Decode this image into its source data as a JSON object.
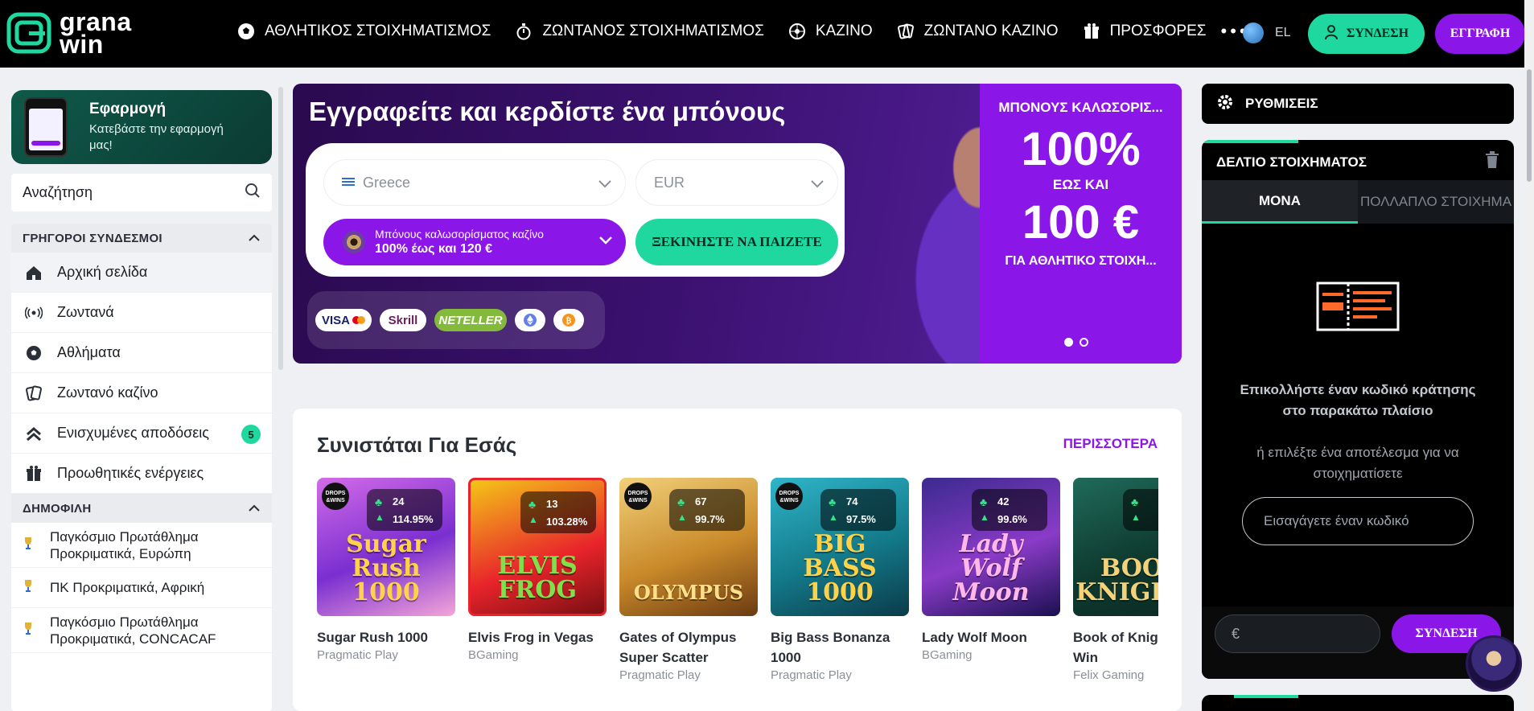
{
  "brand": {
    "name_line1": "grana",
    "name_line2": "win"
  },
  "nav": {
    "items": [
      {
        "label": "ΑΘΛΗΤΙΚΟΣ ΣΤΟΙΧΗΜΑΤΙΣΜΟΣ",
        "icon": "soccer-ball-icon"
      },
      {
        "label": "ΖΩΝΤΑΝΟΣ ΣΤΟΙΧΗΜΑΤΙΣΜΟΣ",
        "icon": "stopwatch-icon"
      },
      {
        "label": "ΚΑΖΙΝΟ",
        "icon": "roulette-icon"
      },
      {
        "label": "ΖΩΝΤΑΝΟ ΚΑΖΙΝΟ",
        "icon": "cards-icon"
      },
      {
        "label": "ΠΡΟΣΦΟΡΕΣ",
        "icon": "gift-icon"
      }
    ],
    "more": "•••",
    "language": "EL",
    "login": "ΣΥΝΔΕΣΗ",
    "register": "ΕΓΓΡΑΦΗ"
  },
  "sidebar": {
    "app_title": "Εφαρμογή",
    "app_sub": "Κατεβάστε την εφαρμογή μας!",
    "search_placeholder": "Αναζήτηση",
    "quick_links_title": "ΓΡΗΓΟΡΟΙ ΣΥΝΔΕΣΜΟΙ",
    "quick_links": [
      {
        "label": "Αρχική σελίδα",
        "icon": "home-icon"
      },
      {
        "label": "Ζωντανά",
        "icon": "live-signal-icon"
      },
      {
        "label": "Αθλήματα",
        "icon": "soccer-ball-icon"
      },
      {
        "label": "Ζωντανό καζίνο",
        "icon": "cards-icon"
      },
      {
        "label": "Ενισχυμένες αποδόσεις",
        "icon": "boost-chevrons-icon",
        "badge": "5"
      },
      {
        "label": "Προωθητικές ενέργειες",
        "icon": "gift-icon"
      }
    ],
    "popular_title": "ΔΗΜΟΦΙΛΗ",
    "popular": [
      {
        "label": "Παγκόσμιο Πρωτάθλημα Προκριματικά, Ευρώπη"
      },
      {
        "label": "ΠΚ Προκριματικά, Αφρική"
      },
      {
        "label": "Παγκόσμιο Πρωτάθλημα Προκριματικά, CONCACAF"
      }
    ]
  },
  "hero": {
    "title": "Εγγραφείτε και κερδίστε ένα μπόνους",
    "country": "Greece",
    "currency": "EUR",
    "bonus_line1": "Μπόνους καλωσορίσματος καζίνο",
    "bonus_line2": "100% έως και 120 €",
    "cta": "ΞΕΚΙΝΗΣΤΕ ΝΑ ΠΑΙΖΕΤΕ",
    "payments": [
      "VISA",
      "Skrill",
      "NETELLER",
      "ETH",
      "BTC"
    ],
    "promo_top": "ΜΠΟΝΟΥΣ ΚΑΛΩΣΟΡΙΣ...",
    "promo_big1": "100%",
    "promo_mid": "ΕΩΣ ΚΑΙ",
    "promo_big2": "100 €",
    "promo_bottom": "ΓΙΑ ΑΘΛΗΤΙΚΟ ΣΤΟΙΧΗ...",
    "slide_index": 1,
    "slide_count": 2
  },
  "recommended": {
    "title": "Συνιστάται Για Εσάς",
    "more": "ΠΕΡΙΣΣΟΤΕΡΑ",
    "games": [
      {
        "title": "Sugar Rush 1000",
        "provider": "Pragmatic Play",
        "players": "24",
        "rtp": "114.95%",
        "art": "Sugar Rush 1000",
        "drops": true
      },
      {
        "title": "Elvis Frog in Vegas",
        "provider": "BGaming",
        "players": "13",
        "rtp": "103.28%",
        "art": "ELVIS FROG",
        "drops": false
      },
      {
        "title": "Gates of Olympus Super Scatter",
        "provider": "Pragmatic Play",
        "players": "67",
        "rtp": "99.7%",
        "art": "OLYMPUS",
        "drops": true
      },
      {
        "title": "Big Bass Bonanza 1000",
        "provider": "Pragmatic Play",
        "players": "74",
        "rtp": "97.5%",
        "art": "BIG BASS 1000",
        "drops": true
      },
      {
        "title": "Lady Wolf Moon",
        "provider": "BGaming",
        "players": "42",
        "rtp": "99.6%",
        "art": "Lady Wolf Moon",
        "drops": false
      },
      {
        "title": "Book of Knights and Win",
        "provider": "Felix Gaming",
        "players": "",
        "rtp": "",
        "art": "BOOK KNIGHTS",
        "drops": false
      }
    ]
  },
  "settings": {
    "label": "ΡΥΘΜΙΣΕΙΣ"
  },
  "betslip": {
    "title": "ΔΕΛΤΙΟ ΣΤΟΙΧΗΜΑΤΟΣ",
    "tab_single": "ΜΟΝΑ",
    "tab_multi": "ΠΟΛΛΑΠΛΟ ΣΤΟΙΧΗΜΑ",
    "message": "Επικολλήστε έναν κωδικό κράτησης στο παρακάτω πλαίσιο",
    "sub": "ή επιλέξτε ένα αποτέλεσμα για να στοιχηματίσετε",
    "code_placeholder": "Εισαγάγετε έναν κωδικό",
    "currency": "€",
    "login": "ΣΥΝΔΕΣΗ"
  },
  "colors": {
    "accent_green": "#1ed8a0",
    "accent_purple": "#8a16e8"
  }
}
